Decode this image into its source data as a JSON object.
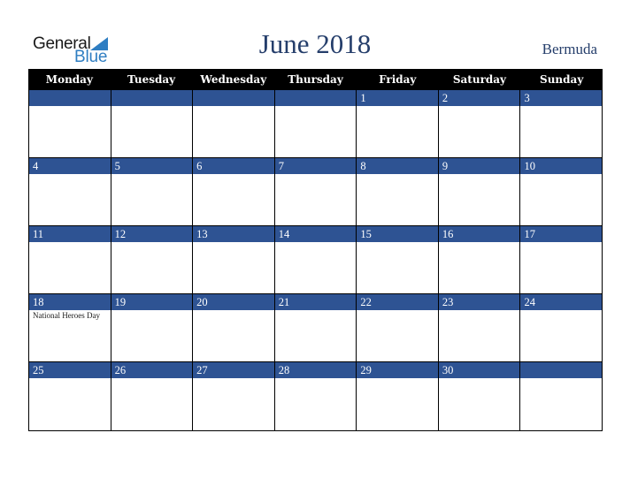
{
  "logo": {
    "line1": "General",
    "line2": "Blue",
    "icon": "triangle-flag-icon",
    "accent": "#2f7ec2"
  },
  "header": {
    "title": "June 2018",
    "country": "Bermuda",
    "title_color": "#253e6b"
  },
  "colors": {
    "day_header_bg": "#000000",
    "date_bar_bg": "#2e5393"
  },
  "weekdays": [
    "Monday",
    "Tuesday",
    "Wednesday",
    "Thursday",
    "Friday",
    "Saturday",
    "Sunday"
  ],
  "weeks": [
    [
      {
        "date": ""
      },
      {
        "date": ""
      },
      {
        "date": ""
      },
      {
        "date": ""
      },
      {
        "date": "1"
      },
      {
        "date": "2"
      },
      {
        "date": "3"
      }
    ],
    [
      {
        "date": "4"
      },
      {
        "date": "5"
      },
      {
        "date": "6"
      },
      {
        "date": "7"
      },
      {
        "date": "8"
      },
      {
        "date": "9"
      },
      {
        "date": "10"
      }
    ],
    [
      {
        "date": "11"
      },
      {
        "date": "12"
      },
      {
        "date": "13"
      },
      {
        "date": "14"
      },
      {
        "date": "15"
      },
      {
        "date": "16"
      },
      {
        "date": "17"
      }
    ],
    [
      {
        "date": "18",
        "event": "National Heroes Day"
      },
      {
        "date": "19"
      },
      {
        "date": "20"
      },
      {
        "date": "21"
      },
      {
        "date": "22"
      },
      {
        "date": "23"
      },
      {
        "date": "24"
      }
    ],
    [
      {
        "date": "25"
      },
      {
        "date": "26"
      },
      {
        "date": "27"
      },
      {
        "date": "28"
      },
      {
        "date": "29"
      },
      {
        "date": "30"
      },
      {
        "date": ""
      }
    ]
  ]
}
